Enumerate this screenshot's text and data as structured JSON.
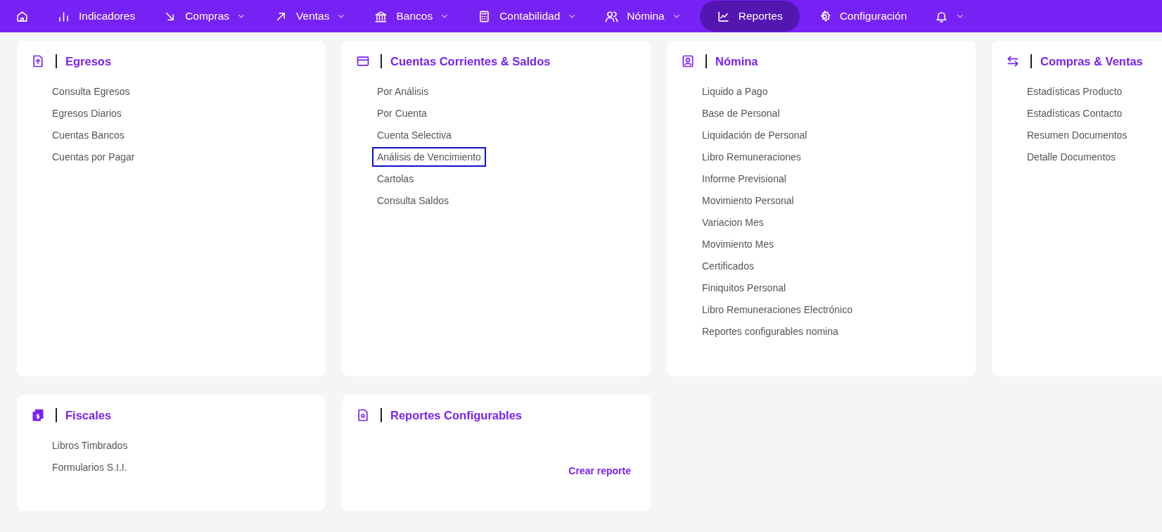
{
  "nav": [
    {
      "caret": false,
      "selected": false
    },
    {
      "label": "Indicadores",
      "caret": false,
      "selected": false
    },
    {
      "label": "Compras",
      "caret": true,
      "selected": false
    },
    {
      "label": "Ventas",
      "caret": true,
      "selected": false
    },
    {
      "label": "Bancos",
      "caret": true,
      "selected": false
    },
    {
      "label": "Contabilidad",
      "caret": true,
      "selected": false
    },
    {
      "label": "Nómina",
      "caret": true,
      "selected": false
    },
    {
      "label": "Reportes",
      "caret": false,
      "selected": true
    },
    {
      "label": "Configuración",
      "caret": false,
      "selected": false
    },
    {
      "caret": true,
      "selected": false
    }
  ],
  "sections": [
    {
      "title": "Egresos",
      "items": [
        {
          "label": "Consulta Egresos",
          "focused": false
        },
        {
          "label": "Egresos Diarios",
          "focused": false
        },
        {
          "label": "Cuentas Bancos",
          "focused": false
        },
        {
          "label": "Cuentas por Pagar",
          "focused": false
        }
      ]
    },
    {
      "title": "Cuentas Corrientes & Saldos",
      "items": [
        {
          "label": "Por Análisis",
          "focused": false
        },
        {
          "label": "Por Cuenta",
          "focused": false
        },
        {
          "label": "Cuenta Selectiva",
          "focused": false
        },
        {
          "label": "Análisis de Vencimiento",
          "focused": true
        },
        {
          "label": "Cartolas",
          "focused": false
        },
        {
          "label": "Consulta Saldos",
          "focused": false
        }
      ]
    },
    {
      "title": "Nómina",
      "items": [
        {
          "label": "Liquido a Pago",
          "focused": false
        },
        {
          "label": "Base de Personal",
          "focused": false
        },
        {
          "label": "Liquidación de Personal",
          "focused": false
        },
        {
          "label": "Libro Remuneraciones",
          "focused": false
        },
        {
          "label": "Informe Previsional",
          "focused": false
        },
        {
          "label": "Movimiento Personal",
          "focused": false
        },
        {
          "label": "Variacion Mes",
          "focused": false
        },
        {
          "label": "Movimiento Mes",
          "focused": false
        },
        {
          "label": "Certificados",
          "focused": false
        },
        {
          "label": "Finiquitos Personal",
          "focused": false
        },
        {
          "label": "Libro Remuneraciones Electrónico",
          "focused": false
        },
        {
          "label": "Reportes configurables nomina",
          "focused": false
        }
      ]
    },
    {
      "title": "Compras & Ventas",
      "items": [
        {
          "label": "Estadísticas Producto",
          "focused": false
        },
        {
          "label": "Estadísticas Contacto",
          "focused": false
        },
        {
          "label": "Resumen Documentos",
          "focused": false
        },
        {
          "label": "Detalle Documentos",
          "focused": false
        }
      ]
    },
    {
      "title": "Fiscales",
      "items": [
        {
          "label": "Libros Timbrados",
          "focused": false
        },
        {
          "label": "Formularios S.I.I.",
          "focused": false
        }
      ]
    },
    {
      "title": "Reportes Configurables",
      "link": "Crear reporte"
    }
  ]
}
